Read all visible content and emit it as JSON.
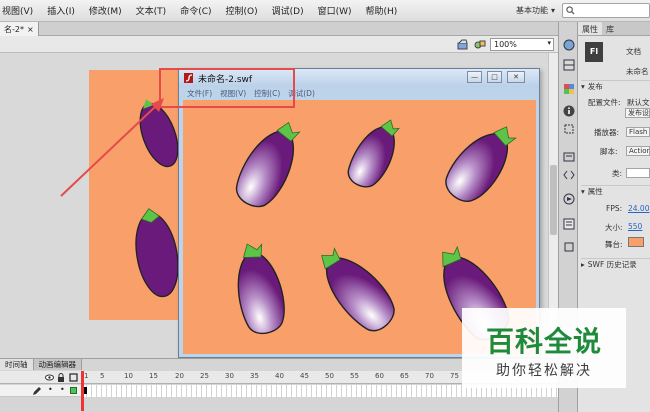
{
  "menubar": {
    "items": [
      "视图(V)",
      "插入(I)",
      "修改(M)",
      "文本(T)",
      "命令(C)",
      "控制(O)",
      "调试(D)",
      "窗口(W)",
      "帮助(H)"
    ],
    "workspace_label": "基本功能"
  },
  "document": {
    "tab_title": "名-2*",
    "zoom": "100%"
  },
  "swf_window": {
    "title": "未命名-2.swf",
    "menu": [
      "文件(F)",
      "视图(V)",
      "控制(C)",
      "调试(D)"
    ]
  },
  "properties": {
    "tabs": [
      "属性",
      "库"
    ],
    "doc_icon_text": "Fl",
    "doc_label": "文档",
    "doc_name": "未命名",
    "publish_section": "发布",
    "config_label": "配置文件:",
    "config_value": "默认文",
    "publish_settings_btn": "发布设",
    "player_label": "播放器:",
    "player_value": "Flash",
    "script_label": "脚本:",
    "script_value": "Action",
    "class_label": "类:",
    "properties_section": "属性",
    "fps_label": "FPS:",
    "fps_value": "24.00",
    "size_label": "大小:",
    "size_value": "550",
    "stage_label": "舞台:",
    "stage_color": "#f9a06a",
    "swf_history": "SWF 历史记录"
  },
  "timeline": {
    "tabs": [
      "时间轴",
      "动画编辑器"
    ],
    "frame_numbers": [
      "1",
      "5",
      "10",
      "15",
      "20",
      "25",
      "30",
      "35",
      "40",
      "45",
      "50",
      "55",
      "60",
      "65",
      "70",
      "75"
    ]
  },
  "watermark": {
    "title": "百科全说",
    "subtitle": "助你轻松解决"
  },
  "colors": {
    "stage_bg": "#f9a06a",
    "eggplant_body": "#6a1a7a",
    "eggplant_cap": "#5ec447",
    "annotation_red": "#e54b4b",
    "watermark_green": "#1f8a3a"
  }
}
